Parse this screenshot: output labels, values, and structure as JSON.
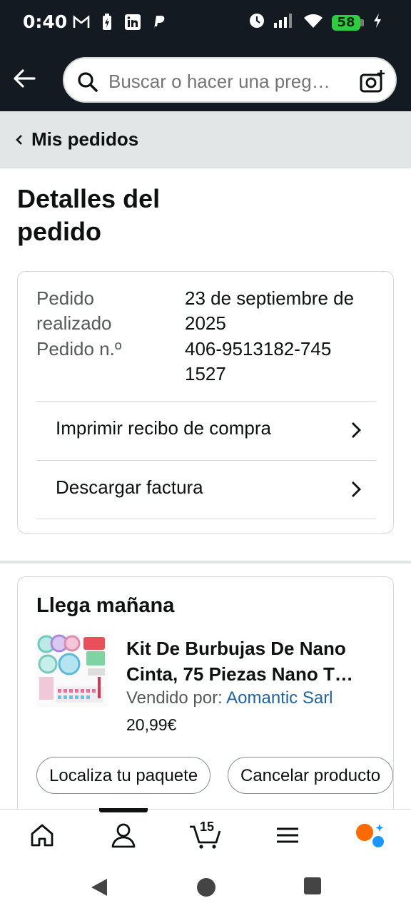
{
  "status_bar": {
    "time": "0:40",
    "battery": "58",
    "icons_left": [
      "gmail-icon",
      "battery-saver-icon",
      "linkedin-icon",
      "paypal-icon"
    ],
    "icons_right": [
      "alarm-icon",
      "signal-icon",
      "wifi-icon",
      "battery-icon",
      "charging-icon"
    ]
  },
  "search": {
    "placeholder": "Buscar o hacer una preg…"
  },
  "breadcrumb": {
    "label": "Mis pedidos"
  },
  "page": {
    "title": "Detalles del pedido"
  },
  "order": {
    "placed_label": "Pedido realizado",
    "placed_value": "23 de septiembre de 2025",
    "number_label": "Pedido n.º",
    "number_value": "406-9513182-7451527",
    "links": [
      {
        "label": "Imprimir recibo de compra"
      },
      {
        "label": "Descargar factura"
      }
    ]
  },
  "shipment": {
    "status": "Llega mañana",
    "product_title": "Kit De Burbujas De Nano Cinta, 75 Piezas Nano T…",
    "seller_prefix": "Vendido por: ",
    "seller_name": "Aomantic Sarl",
    "price": "20,99€",
    "buttons": [
      {
        "label": "Localiza tu paquete"
      },
      {
        "label": "Cancelar producto"
      }
    ]
  },
  "bottom_nav": {
    "cart_count": "15",
    "items": [
      "home-icon",
      "account-icon",
      "cart-icon",
      "menu-icon",
      "rufus-icon"
    ],
    "active": "account-icon"
  },
  "colors": {
    "header_bg": "#131a22",
    "link": "#2162a1",
    "breadcrumb_bg": "#e3e6e6",
    "rufus_orange": "#ff6a00",
    "rufus_blue": "#1a98ff"
  }
}
